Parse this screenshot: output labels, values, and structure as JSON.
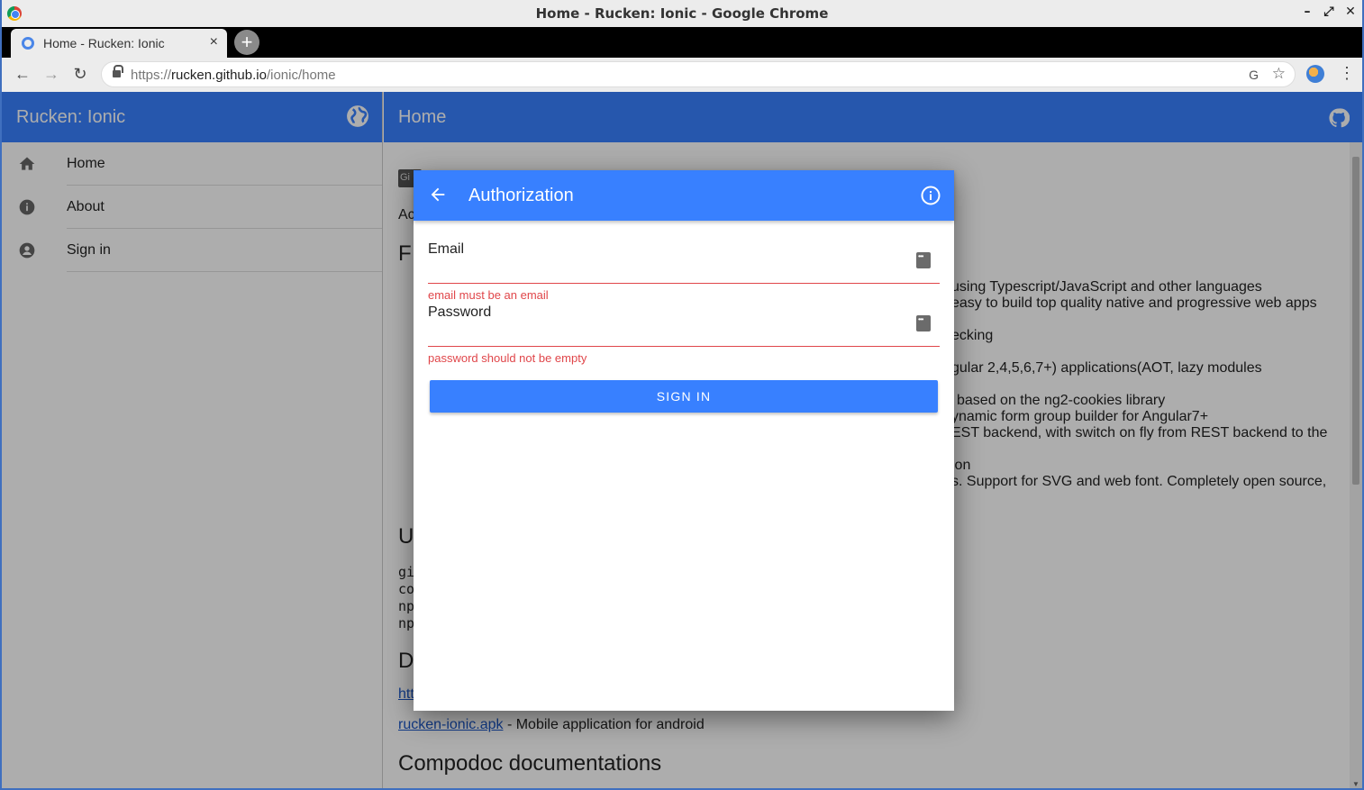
{
  "window": {
    "title": "Home - Rucken: Ionic - Google Chrome",
    "controls": [
      "–",
      "⤢",
      "✕"
    ]
  },
  "browser": {
    "tab_title": "Home - Rucken: Ionic",
    "tab_close": "×",
    "new_tab": "+",
    "url_scheme": "https://",
    "url_host": "rucken.github.io",
    "url_path": "/ionic/home",
    "back_glyph": "←",
    "forward_glyph": "→",
    "reload_glyph": "↻",
    "translate_glyph": "G",
    "star_glyph": "☆",
    "menu_glyph": "⋮"
  },
  "sidebar": {
    "title": "Rucken: Ionic",
    "items": [
      {
        "label": "Home",
        "icon": "home-icon"
      },
      {
        "label": "About",
        "icon": "info-icon"
      },
      {
        "label": "Sign in",
        "icon": "account-icon"
      }
    ]
  },
  "main": {
    "title": "Home",
    "content": {
      "badge": "Gi",
      "line_ac": "Ac",
      "heading_f": "F",
      "line1": "using Typescript/JavaScript and other languages",
      "line2": "easy to build top quality native and progressive web apps",
      "line3": "ecking",
      "line4": "gular 2,4,5,6,7+) applications(AOT, lazy modules",
      "line5": "based on the ng2-cookies library",
      "line6": "ynamic form group builder for Angular7+",
      "line7": "EST backend, with switch on fly from REST backend to the",
      "line8": "ion",
      "line9": "s. Support for SVG and web font. Completely open source,",
      "heading_u": "U",
      "code1": "gi",
      "code2": "co",
      "code3": "np",
      "code4": "np",
      "heading_d": "D",
      "link_ht": "htt",
      "apk_link": "rucken-ionic.apk",
      "apk_desc": " - Mobile application for android",
      "heading_compodoc": "Compodoc documentations"
    }
  },
  "modal": {
    "title": "Authorization",
    "email_label": "Email",
    "email_value": "",
    "email_error": "email must be an email",
    "password_label": "Password",
    "password_value": "",
    "password_error": "password should not be empty",
    "signin_label": "SIGN IN"
  },
  "colors": {
    "primary": "#3880ff",
    "danger": "#e0464a"
  }
}
